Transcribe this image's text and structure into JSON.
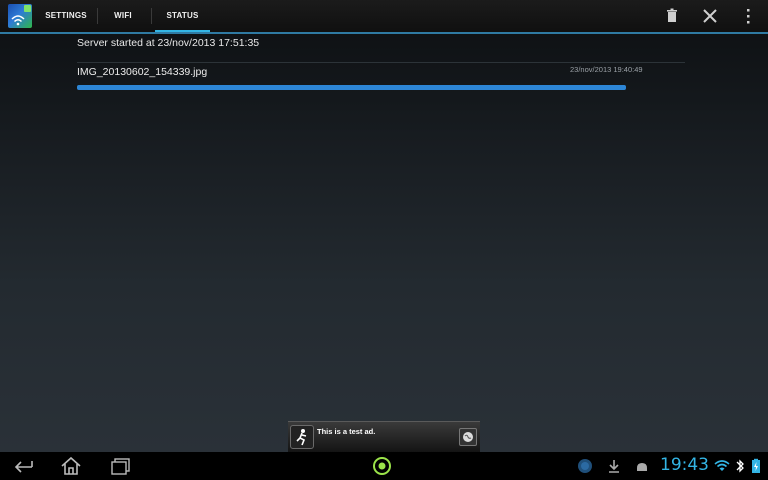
{
  "tabs": [
    {
      "label": "SETTINGS"
    },
    {
      "label": "WIFI"
    },
    {
      "label": "STATUS",
      "selected": true
    }
  ],
  "action_icons": [
    "trash-icon",
    "close-icon",
    "overflow-menu-icon"
  ],
  "status": {
    "server_line": "Server started at 23/nov/2013 17:51:35",
    "transfer": {
      "file_name": "IMG_20130602_154339.jpg",
      "timestamp": "23/nov/2013 19:40:49",
      "progress": 1.0
    }
  },
  "ad": {
    "text": "This is a test ad."
  },
  "system_bar": {
    "clock": "19:43"
  },
  "colors": {
    "accent": "#33b5e5",
    "progress": "#2d86d6"
  }
}
